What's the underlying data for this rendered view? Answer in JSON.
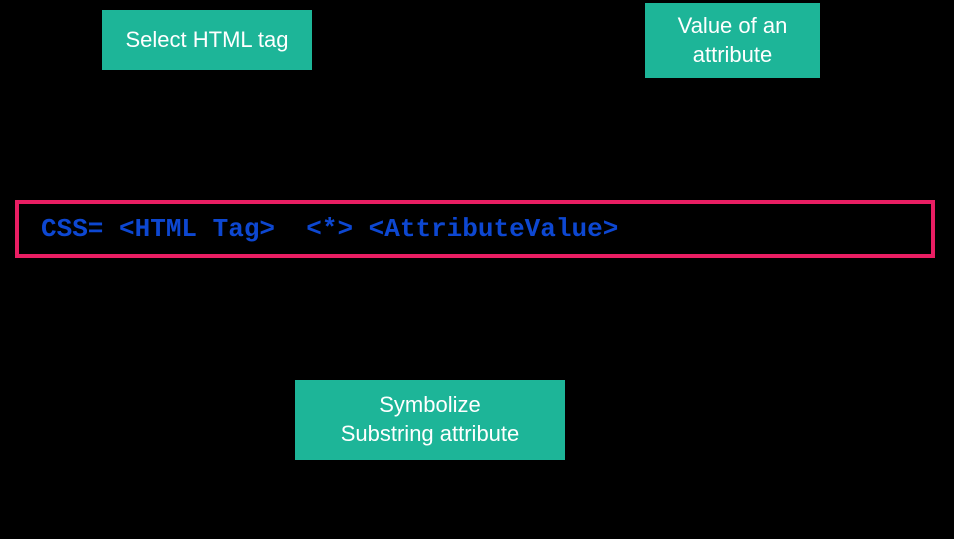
{
  "labels": {
    "topLeft": "Select HTML tag",
    "topRight": "Value of an\nattribute",
    "bottom": "Symbolize\nSubstring attribute"
  },
  "code": "CSS= <HTML Tag>  <*> <AttributeValue>",
  "colors": {
    "labelBackground": "#1db598",
    "labelText": "#ffffff",
    "codeBorder": "#e91e63",
    "codeText": "#0d47d1",
    "pageBackground": "#000000"
  }
}
